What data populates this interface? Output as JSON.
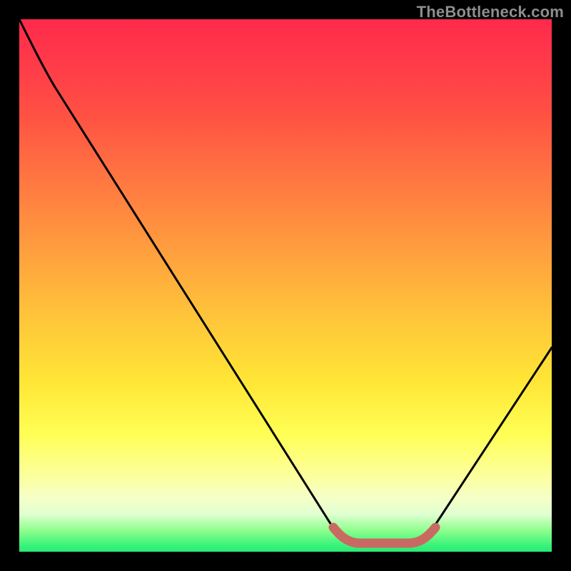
{
  "watermark": "TheBottleneck.com",
  "colors": {
    "background": "#000000",
    "gradient_top": "#ff2a4b",
    "gradient_mid": "#ffe636",
    "gradient_bottom": "#2ee874",
    "curve_stroke": "#000000",
    "flat_segment_stroke": "#c96a62",
    "watermark_text": "#8e8e8e"
  },
  "chart_data": {
    "type": "line",
    "title": "",
    "xlabel": "",
    "ylabel": "",
    "xlim": [
      0,
      100
    ],
    "ylim": [
      0,
      100
    ],
    "x": [
      0,
      5,
      10,
      15,
      20,
      25,
      30,
      35,
      40,
      45,
      50,
      55,
      60,
      65,
      70,
      75,
      80,
      85,
      90,
      95,
      100
    ],
    "y": [
      100,
      92,
      84,
      76,
      68,
      60,
      52,
      44,
      36,
      28,
      20,
      12,
      5,
      2,
      2,
      2,
      6,
      14,
      22,
      30,
      38
    ],
    "flat_segment": {
      "x_start": 60,
      "x_end": 76,
      "y": 2
    },
    "annotations": []
  }
}
